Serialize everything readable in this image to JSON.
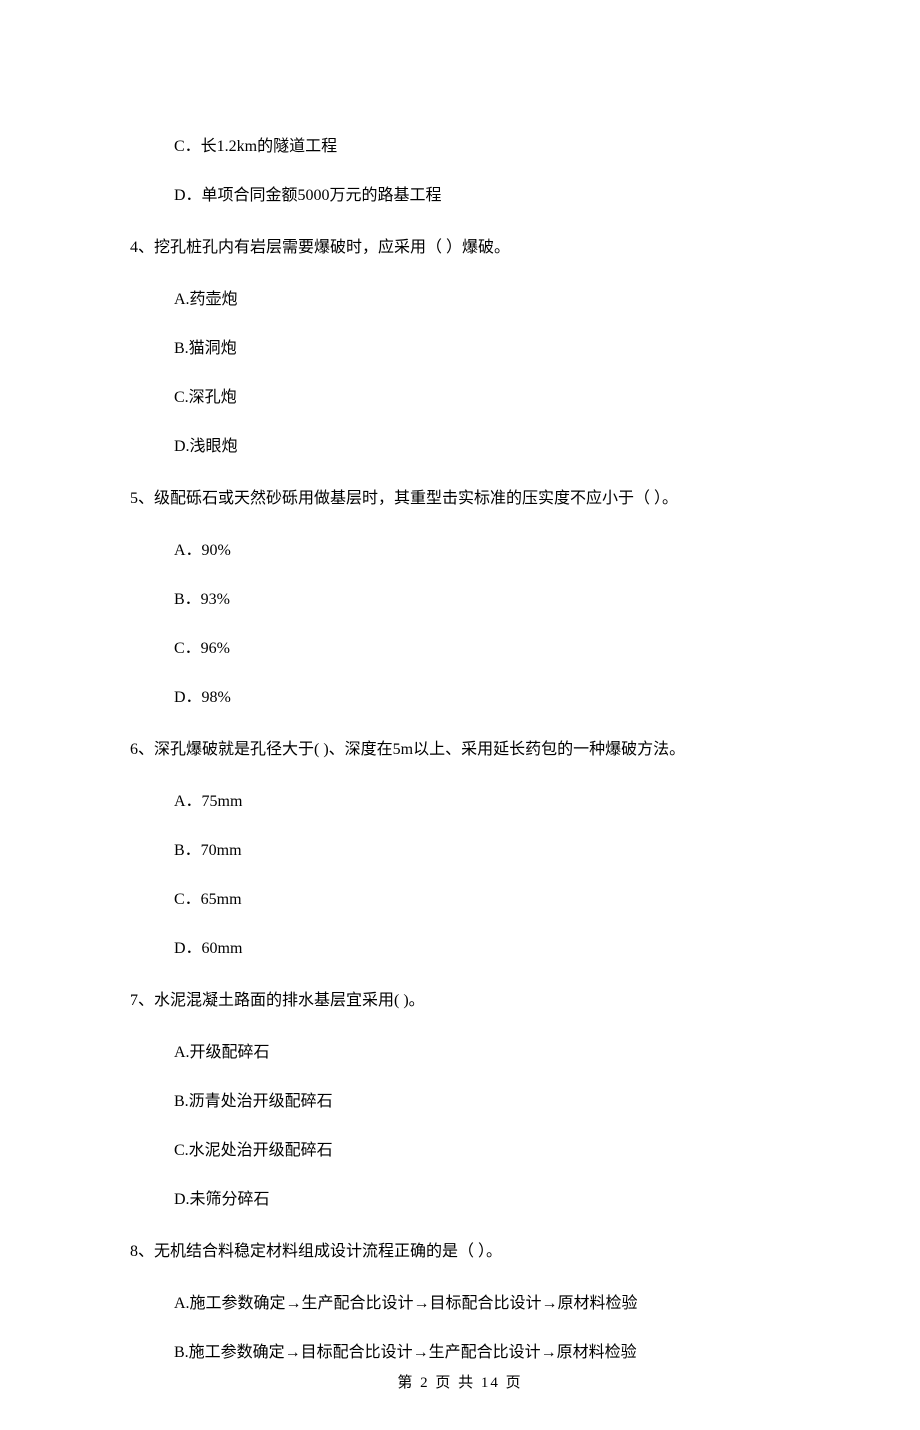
{
  "options_top": [
    "C．长1.2km的隧道工程",
    "D．单项合同金额5000万元的路基工程"
  ],
  "q4": {
    "stem": "4、挖孔桩孔内有岩层需要爆破时，应采用（   ）爆破。",
    "opts": [
      "A.药壶炮",
      "B.猫洞炮",
      "C.深孔炮",
      "D.浅眼炮"
    ]
  },
  "q5": {
    "stem": "5、级配砾石或天然砂砾用做基层时，其重型击实标准的压实度不应小于（    ）。",
    "opts": [
      "A．90%",
      "B．93%",
      "C．96%",
      "D．98%"
    ]
  },
  "q6": {
    "stem": "6、深孔爆破就是孔径大于(    )、深度在5m以上、采用延长药包的一种爆破方法。",
    "opts": [
      "A．75mm",
      "B．70mm",
      "C．65mm",
      "D．60mm"
    ]
  },
  "q7": {
    "stem": "7、水泥混凝土路面的排水基层宜采用(     )。",
    "opts": [
      "A.开级配碎石",
      "B.沥青处治开级配碎石",
      "C.水泥处治开级配碎石",
      "D.未筛分碎石"
    ]
  },
  "q8": {
    "stem": "8、无机结合料稳定材料组成设计流程正确的是（    ）。",
    "opts": [
      "A.施工参数确定→生产配合比设计→目标配合比设计→原材料检验",
      "B.施工参数确定→目标配合比设计→生产配合比设计→原材料检验"
    ]
  },
  "footer": "第 2 页 共 14 页"
}
